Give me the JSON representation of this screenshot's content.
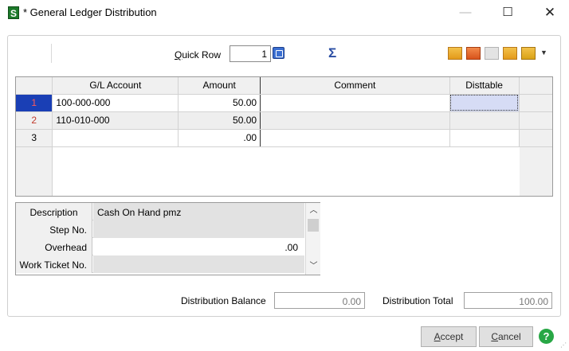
{
  "window": {
    "app_icon_glyph": "S",
    "title": "* General Ledger Distribution",
    "controls": {
      "minimize": "—",
      "maximize": "☐",
      "close": "✕"
    }
  },
  "toolbar": {
    "quick_row_label_u": "Q",
    "quick_row_label_rest": "uick Row",
    "quick_row_value": "1",
    "sigma": "Σ",
    "icons": [
      "insert-row-icon",
      "delete-row-icon",
      "copy-row-icon",
      "paste-row-icon",
      "more-actions-icon"
    ],
    "dropdown_glyph": "▼"
  },
  "grid": {
    "columns": [
      "G/L Account",
      "Amount",
      "Comment",
      "Disttable"
    ],
    "rows": [
      {
        "num": "1",
        "account": "100-000-000",
        "amount": "50.00",
        "comment": "",
        "disttable": ""
      },
      {
        "num": "2",
        "account": "110-010-000",
        "amount": "50.00",
        "comment": "",
        "disttable": ""
      },
      {
        "num": "3",
        "account": "",
        "amount": ".00",
        "comment": "",
        "disttable": ""
      }
    ]
  },
  "detail": {
    "description_label": "Description",
    "description_value": "Cash On Hand pmz",
    "step_label": "Step No.",
    "step_value": "",
    "overhead_label": "Overhead",
    "overhead_value": ".00",
    "work_ticket_label": "Work Ticket No.",
    "work_ticket_value": "",
    "scroll_up": "︿",
    "scroll_down": "﹀"
  },
  "footer": {
    "balance_label": "Distribution Balance",
    "balance_value": "0.00",
    "total_label": "Distribution Total",
    "total_value": "100.00"
  },
  "buttons": {
    "accept_u": "A",
    "accept_rest": "ccept",
    "cancel_u": "C",
    "cancel_rest": "ancel",
    "help": "?"
  },
  "colors": {
    "selected_row_header": "#1a3fb5",
    "row_number_red": "#c0392b",
    "help_green": "#28a745"
  }
}
